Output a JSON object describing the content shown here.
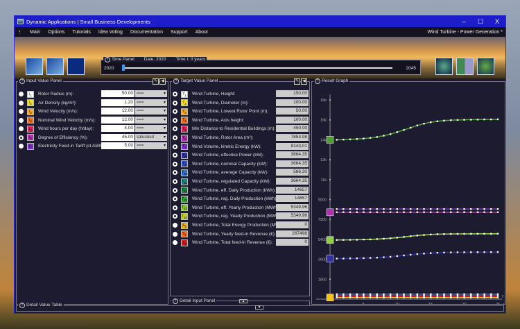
{
  "window": {
    "title": "Dynamic Applications | Small Business Developments",
    "min": "–",
    "max": "☐",
    "close": "X"
  },
  "menu": {
    "items": [
      "Main",
      "Options",
      "Tutorials",
      "Idea Voting",
      "Documentation",
      "Support",
      "About"
    ],
    "right": "Wind Turbine - Power Generation *"
  },
  "time_panel": {
    "title": "Time Panel",
    "date": "Date:  2020",
    "time": "Time t:  0  years",
    "start": "2020",
    "end": "2045",
    "progress": 0
  },
  "input_panel": {
    "title": "Input Value Panel",
    "rows": [
      {
        "sym": "i1",
        "label": "Rotor Radius (m):",
        "value": "50.00",
        "option": "===",
        "color": "#ffffff",
        "radio": "filled"
      },
      {
        "sym": "i2",
        "label": "Air Density (kg/m³):",
        "value": "1.20",
        "option": "===",
        "color": "#f4e21c",
        "radio": "filled"
      },
      {
        "sym": "i3",
        "label": "Wind Velocity (m/s):",
        "value": "12.00",
        "option": "===",
        "color": "#f5a623",
        "radio": "filled"
      },
      {
        "sym": "i4",
        "label": "Nominal Wind Velocity (m/s):",
        "value": "12.00",
        "option": "===",
        "color": "#f07020",
        "radio": "filled"
      },
      {
        "sym": "i5",
        "label": "Wind hours per day (h/day):",
        "value": "4.00",
        "option": "===",
        "color": "#e0205a",
        "radio": "filled"
      },
      {
        "sym": "i6",
        "label": "Degree of Efficiency (%):",
        "value": "45.00",
        "option": "saturated",
        "color": "#b030b0",
        "radio": "ring"
      },
      {
        "sym": "i7",
        "label": "Electricity Feed-in Tariff (ct./kWh):",
        "value": "5.00",
        "option": "===",
        "color": "#7a30c0",
        "radio": "filled"
      }
    ]
  },
  "target_panel": {
    "title": "Target Value Panel",
    "rows": [
      {
        "sym": "T1",
        "label": "Wind Turbine, Height:",
        "value": "150.00",
        "color": "#ffffff",
        "radio": "ring"
      },
      {
        "sym": "T2",
        "label": "Wind Turbine, Diameter (m):",
        "value": "100.00",
        "color": "#f4e21c",
        "radio": "ring"
      },
      {
        "sym": "T3",
        "label": "Wind Turbine, Lowest Rotor Point (m):",
        "value": "50.00",
        "color": "#f5a623",
        "radio": "ring"
      },
      {
        "sym": "T4",
        "label": "Wind Turbine, Axis height:",
        "value": "100.00",
        "color": "#f07020",
        "radio": "ring"
      },
      {
        "sym": "T5",
        "label": "Min Distance to Residential Buildings (m):",
        "value": "450.00",
        "color": "#e0205a",
        "radio": "ring"
      },
      {
        "sym": "T6",
        "label": "Wind Turbine, Rotor Area (m²):",
        "value": "7853.98",
        "color": "#b030b0",
        "radio": "ring"
      },
      {
        "sym": "T7",
        "label": "Wind Volume, kinetic Energy (kW):",
        "value": "8143.01",
        "color": "#7a30c0",
        "radio": "ring"
      },
      {
        "sym": "T8",
        "label": "Wind Turbine, effective Power (kW):",
        "value": "3664.35",
        "color": "#3030a0",
        "radio": "ring"
      },
      {
        "sym": "T9",
        "label": "Wind Turbine, nominal Capacity (kW):",
        "value": "3664.35",
        "color": "#3050c0",
        "radio": "ring"
      },
      {
        "sym": "T10",
        "label": "Wind Turbine, average Capacity (kW):",
        "value": "586.30",
        "color": "#3070c0",
        "radio": "ring"
      },
      {
        "sym": "T11",
        "label": "Wind Turbine, regulated Capacity (kW):",
        "value": "3664.35",
        "color": "#208080",
        "radio": "ring"
      },
      {
        "sym": "T12",
        "label": "Wind Turbine, eff. Daily Production (kWh):",
        "value": "14657",
        "color": "#208040",
        "radio": "ring"
      },
      {
        "sym": "T13",
        "label": "Wind Turbine, reg. Daily Production (kWh):",
        "value": "14657",
        "color": "#30a030",
        "radio": "ring"
      },
      {
        "sym": "T14",
        "label": "Wind Turbine, eff. Yearly Production (MWh):",
        "value": "5349.96",
        "color": "#80c030",
        "radio": "ring"
      },
      {
        "sym": "T15",
        "label": "Wind Turbine, reg. Yearly Production (MWh):",
        "value": "5349.96",
        "color": "#c0d020",
        "radio": "ring"
      },
      {
        "sym": "S1",
        "label": "Wind Turbine, Total Energy Production (MWh):",
        "value": "0",
        "color": "#e0b020",
        "radio": "filled"
      },
      {
        "sym": "S2",
        "label": "Wind Turbine, Yearly feed-in Revenue (€):",
        "value": "267498",
        "color": "#f07020",
        "radio": "filled"
      },
      {
        "sym": "S3",
        "label": "Wind Turbine, Total feed-in Revenue (€):",
        "value": "0",
        "color": "#d02020",
        "radio": "filled"
      }
    ]
  },
  "result_graph": {
    "title": "Result Graph"
  },
  "detail_input": {
    "title": "Detail Input Panel"
  },
  "detail_table": {
    "title": "Detail Value Table"
  },
  "chart_data": {
    "type": "line",
    "xlabel": "t",
    "ylabel": "y",
    "xlim": [
      0,
      25
    ],
    "ylim": [
      0,
      18000
    ],
    "xticks": [
      "5",
      "10",
      "15",
      "20",
      "25"
    ],
    "yticks": [
      "1800",
      "3600",
      "5400",
      "7200",
      "9000",
      "11k",
      "13k",
      "14k",
      "16k",
      "18k"
    ],
    "series": [
      {
        "name": "T13",
        "color": "#50a030",
        "marker": "T13",
        "values": [
          14400,
          14420,
          14440,
          14470,
          14510,
          14570,
          14650,
          14770,
          14910,
          15090,
          15290,
          15490,
          15690,
          15860,
          15990,
          16070,
          16130,
          16170,
          16190,
          16210,
          16220,
          16230,
          16240,
          16240,
          16250
        ]
      },
      {
        "name": "T7",
        "color": "#7a30c0",
        "values": [
          8143,
          8143,
          8143,
          8143,
          8143,
          8143,
          8143,
          8143,
          8143,
          8143,
          8143,
          8143,
          8143,
          8143,
          8143,
          8143,
          8143,
          8143,
          8143,
          8143,
          8143,
          8143,
          8143,
          8143,
          8143
        ]
      },
      {
        "name": "T6",
        "color": "#b030b0",
        "marker": "T6",
        "values": [
          7854,
          7854,
          7854,
          7854,
          7854,
          7854,
          7854,
          7854,
          7854,
          7854,
          7854,
          7854,
          7854,
          7854,
          7854,
          7854,
          7854,
          7854,
          7854,
          7854,
          7854,
          7854,
          7854,
          7854,
          7854
        ]
      },
      {
        "name": "T14",
        "color": "#90d040",
        "marker": "T14",
        "values": [
          5350,
          5355,
          5362,
          5370,
          5385,
          5400,
          5425,
          5460,
          5500,
          5560,
          5620,
          5690,
          5750,
          5800,
          5840,
          5865,
          5880,
          5890,
          5895,
          5900,
          5902,
          5904,
          5906,
          5908,
          5910
        ]
      },
      {
        "name": "T8",
        "color": "#3030a0",
        "marker": "T8",
        "values": [
          3664,
          3670,
          3680,
          3690,
          3705,
          3725,
          3750,
          3785,
          3830,
          3890,
          3950,
          4010,
          4070,
          4120,
          4160,
          4190,
          4210,
          4220,
          4228,
          4234,
          4238,
          4242,
          4245,
          4248,
          4250
        ]
      },
      {
        "name": "T5",
        "color": "#3a6ab0",
        "values": [
          450,
          450,
          450,
          450,
          450,
          450,
          450,
          450,
          450,
          450,
          450,
          450,
          450,
          450,
          450,
          450,
          450,
          450,
          450,
          450,
          450,
          450,
          450,
          450,
          450
        ]
      },
      {
        "name": "T4",
        "color": "#e0205a",
        "values": [
          300,
          300,
          300,
          300,
          300,
          300,
          300,
          300,
          300,
          300,
          300,
          300,
          300,
          300,
          300,
          300,
          300,
          300,
          300,
          300,
          300,
          300,
          300,
          300,
          300
        ]
      },
      {
        "name": "T1",
        "color": "#f4c21c",
        "marker": "T1",
        "values": [
          150,
          150,
          150,
          150,
          150,
          150,
          150,
          150,
          150,
          150,
          150,
          150,
          150,
          150,
          150,
          150,
          150,
          150,
          150,
          150,
          150,
          150,
          150,
          150,
          150
        ]
      }
    ]
  }
}
